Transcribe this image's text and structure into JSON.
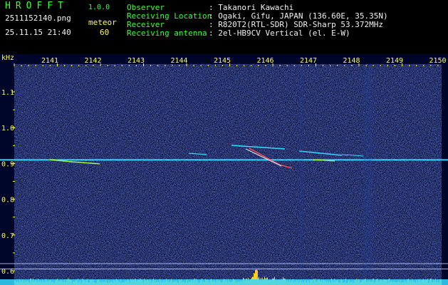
{
  "app": {
    "name": "HROFFT",
    "version": "1.0.0"
  },
  "file": {
    "name": "2511152140.png",
    "timestamp": "25.11.15 21:40"
  },
  "meteor": {
    "label": "meteor",
    "count": "60"
  },
  "station": [
    {
      "key": "Observer",
      "value": ": Takanori Kawachi"
    },
    {
      "key": "Receiving Location",
      "value": ": Ogaki, Gifu, JAPAN (136.60E, 35.35N)"
    },
    {
      "key": "Receiver",
      "value": ": R820T2(RTL-SDR) SDR-Sharp 53.372MHz"
    },
    {
      "key": "Receiving antenna",
      "value": ": 2el-HB9CV Vertical (el. E-W)"
    }
  ],
  "colors": {
    "label_yellow": "#ffff3a",
    "label_green": "#3cff3c",
    "background": "#00062a",
    "signal": "#35d8ff"
  },
  "chart_data": {
    "type": "heatmap",
    "yunit": "kHz",
    "x_ticks": [
      "2141",
      "2142",
      "2143",
      "2144",
      "2145",
      "2146",
      "2147",
      "2148",
      "2149",
      "2150"
    ],
    "y_ticks": [
      "1.1",
      "1.0",
      "0.9",
      "0.8",
      "0.7",
      "0.6"
    ],
    "ylim": [
      0.6,
      1.15
    ],
    "carrier_khz": 0.91,
    "reference_lines_khz": [
      0.62,
      0.605
    ]
  }
}
